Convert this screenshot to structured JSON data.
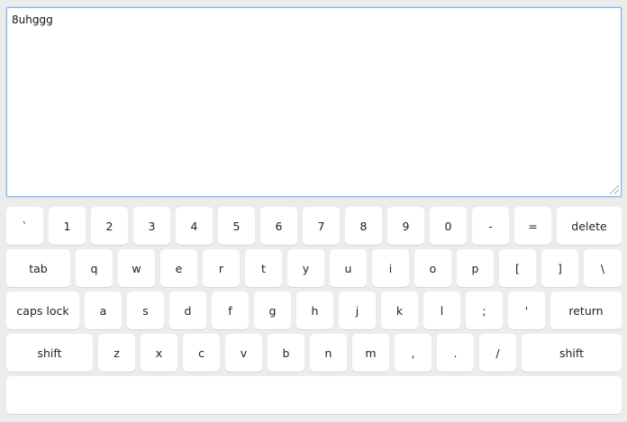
{
  "editor": {
    "value": "8uhggg"
  },
  "keyboard": {
    "rows": [
      {
        "keys": [
          {
            "label": "`",
            "name": "key-backtick"
          },
          {
            "label": "1",
            "name": "key-1"
          },
          {
            "label": "2",
            "name": "key-2"
          },
          {
            "label": "3",
            "name": "key-3"
          },
          {
            "label": "4",
            "name": "key-4"
          },
          {
            "label": "5",
            "name": "key-5"
          },
          {
            "label": "6",
            "name": "key-6"
          },
          {
            "label": "7",
            "name": "key-7"
          },
          {
            "label": "8",
            "name": "key-8"
          },
          {
            "label": "9",
            "name": "key-9"
          },
          {
            "label": "0",
            "name": "key-0"
          },
          {
            "label": "-",
            "name": "key-minus"
          },
          {
            "label": "=",
            "name": "key-equals"
          },
          {
            "label": "delete",
            "name": "key-delete"
          }
        ]
      },
      {
        "keys": [
          {
            "label": "tab",
            "name": "key-tab"
          },
          {
            "label": "q",
            "name": "key-q"
          },
          {
            "label": "w",
            "name": "key-w"
          },
          {
            "label": "e",
            "name": "key-e"
          },
          {
            "label": "r",
            "name": "key-r"
          },
          {
            "label": "t",
            "name": "key-t"
          },
          {
            "label": "y",
            "name": "key-y"
          },
          {
            "label": "u",
            "name": "key-u"
          },
          {
            "label": "i",
            "name": "key-i"
          },
          {
            "label": "o",
            "name": "key-o"
          },
          {
            "label": "p",
            "name": "key-p"
          },
          {
            "label": "[",
            "name": "key-left-bracket"
          },
          {
            "label": "]",
            "name": "key-right-bracket"
          },
          {
            "label": "\\",
            "name": "key-backslash"
          }
        ]
      },
      {
        "keys": [
          {
            "label": "caps lock",
            "name": "key-caps-lock"
          },
          {
            "label": "a",
            "name": "key-a"
          },
          {
            "label": "s",
            "name": "key-s"
          },
          {
            "label": "d",
            "name": "key-d"
          },
          {
            "label": "f",
            "name": "key-f"
          },
          {
            "label": "g",
            "name": "key-g"
          },
          {
            "label": "h",
            "name": "key-h"
          },
          {
            "label": "j",
            "name": "key-j"
          },
          {
            "label": "k",
            "name": "key-k"
          },
          {
            "label": "l",
            "name": "key-l"
          },
          {
            "label": ";",
            "name": "key-semicolon"
          },
          {
            "label": "'",
            "name": "key-quote"
          },
          {
            "label": "return",
            "name": "key-return"
          }
        ]
      },
      {
        "keys": [
          {
            "label": "shift",
            "name": "key-shift-left"
          },
          {
            "label": "z",
            "name": "key-z"
          },
          {
            "label": "x",
            "name": "key-x"
          },
          {
            "label": "c",
            "name": "key-c"
          },
          {
            "label": "v",
            "name": "key-v"
          },
          {
            "label": "b",
            "name": "key-b"
          },
          {
            "label": "n",
            "name": "key-n"
          },
          {
            "label": "m",
            "name": "key-m"
          },
          {
            "label": ",",
            "name": "key-comma"
          },
          {
            "label": ".",
            "name": "key-period"
          },
          {
            "label": "/",
            "name": "key-slash"
          },
          {
            "label": "shift",
            "name": "key-shift-right"
          }
        ]
      },
      {
        "keys": [
          {
            "label": "",
            "name": "key-space"
          }
        ]
      }
    ]
  }
}
